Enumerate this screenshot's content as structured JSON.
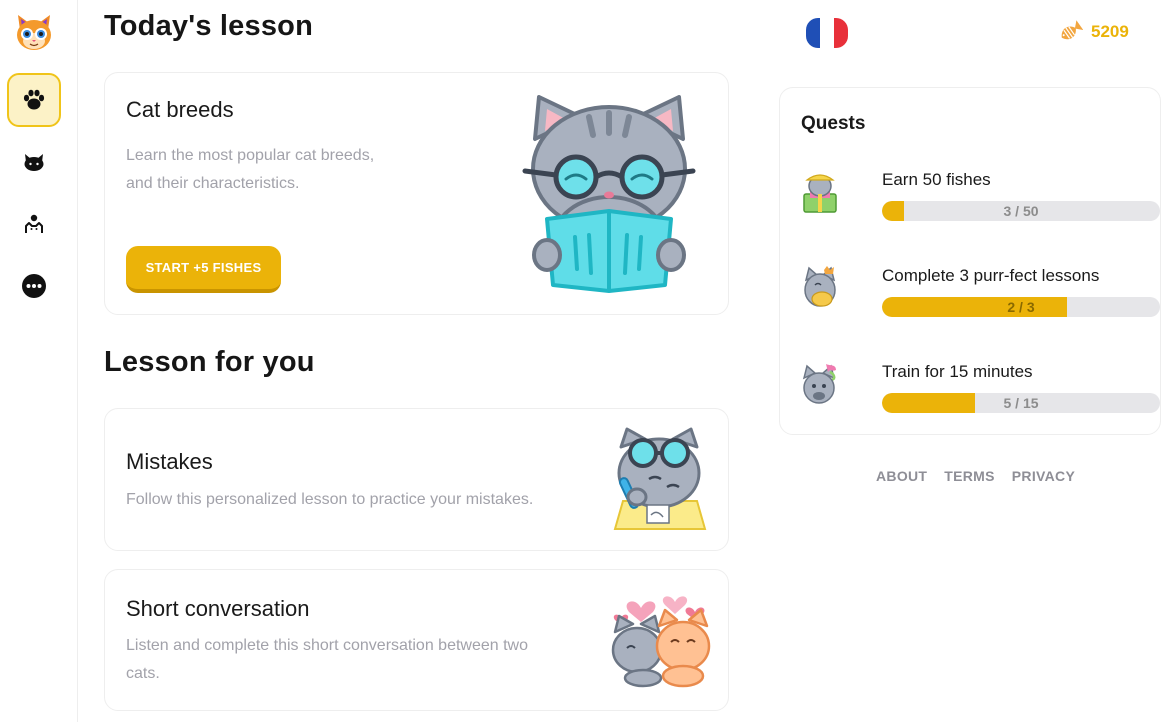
{
  "sidebar": {
    "logo_icon": "cat-face-logo",
    "items": [
      {
        "icon": "paw-icon",
        "active": true
      },
      {
        "icon": "cat-icon",
        "active": false
      },
      {
        "icon": "cat-profile-icon",
        "active": false
      },
      {
        "icon": "more-icon",
        "active": false
      }
    ]
  },
  "header": {
    "flag": {
      "icon": "france-flag-icon",
      "colors": [
        "#1f4fb6",
        "#ffffff",
        "#e8303a"
      ]
    },
    "fish": {
      "icon": "fish-icon",
      "count": "5209"
    }
  },
  "today": {
    "section_title": "Today's lesson",
    "card": {
      "title": "Cat breeds",
      "description_line1": "Learn the most popular cat breeds,",
      "description_line2": "and their characteristics.",
      "button_label": "START +5 FISHES",
      "illustration": "cat-reading-book-illustration"
    }
  },
  "for_you": {
    "section_title": "Lesson for you",
    "cards": [
      {
        "title": "Mistakes",
        "description": "Follow this personalized lesson to practice your mistakes.",
        "illustration": "cat-writing-illustration"
      },
      {
        "title": "Short conversation",
        "description_line1": "Listen and complete this short conversation between two",
        "description_line2": "cats.",
        "illustration": "two-cats-hearts-illustration"
      }
    ]
  },
  "quests": {
    "title": "Quests",
    "items": [
      {
        "name": "Earn 50 fishes",
        "progress_text": "3 / 50",
        "progress": 0.06,
        "icon": "cat-gift-icon"
      },
      {
        "name": "Complete 3 purr-fect lessons",
        "progress_text": "2 / 3",
        "progress": 0.667,
        "icon": "cat-vip-icon"
      },
      {
        "name": "Train for 15 minutes",
        "progress_text": "5 / 15",
        "progress": 0.333,
        "icon": "cat-unicorn-icon"
      }
    ]
  },
  "footer": {
    "about": "ABOUT",
    "terms": "TERMS",
    "privacy": "PRIVACY"
  },
  "colors": {
    "accent": "#ebb309",
    "accent_dark": "#c99400",
    "active_nav_bg": "#fcf2c7",
    "muted_text": "#a2a2aa",
    "bar_track": "#e6e6e9"
  }
}
